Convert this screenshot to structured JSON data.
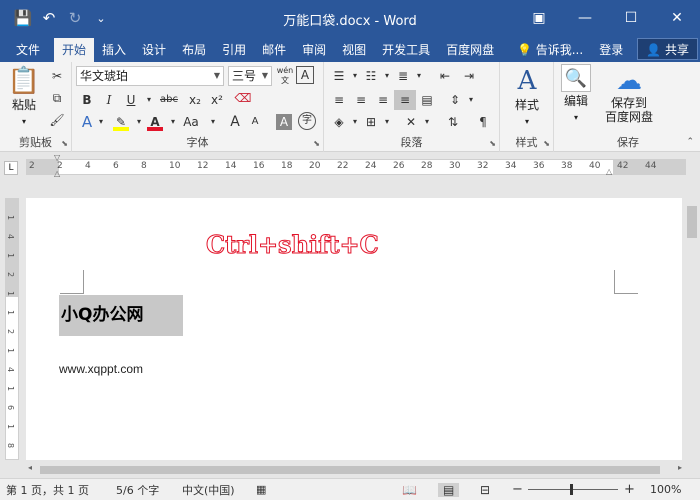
{
  "window": {
    "title": "万能口袋.docx - Word",
    "controls": [
      "restore-icon",
      "minimize-icon",
      "maximize-icon",
      "close-icon"
    ]
  },
  "qat": {
    "save_icon": "💾",
    "undo_icon": "↶",
    "redo_icon": "↻",
    "customize_icon": "⌄"
  },
  "tabs": [
    "文件",
    "开始",
    "插入",
    "设计",
    "布局",
    "引用",
    "邮件",
    "审阅",
    "视图",
    "开发工具",
    "百度网盘"
  ],
  "active_tab": "开始",
  "tellme": "告诉我...",
  "login": "登录",
  "share": "共享",
  "ribbon": {
    "clipboard": {
      "label": "剪贴板",
      "paste": "粘贴"
    },
    "font": {
      "label": "字体",
      "font_name": "华文琥珀",
      "font_size": "三号",
      "bold": "B",
      "italic": "I",
      "underline": "U",
      "strike": "abc",
      "subscript": "x₂",
      "superscript": "x²",
      "change_case": "Aa",
      "grow": "A",
      "shrink": "A",
      "highlight_color": "#ffff00",
      "font_color": "#e2142a"
    },
    "paragraph": {
      "label": "段落"
    },
    "styles": {
      "label": "样式",
      "button": "样式"
    },
    "editing": {
      "button": "编辑"
    },
    "save": {
      "label": "保存",
      "button_line1": "保存到",
      "button_line2": "百度网盘"
    }
  },
  "ruler": {
    "tab_selector": "L",
    "numbers": [
      "2",
      "2",
      "4",
      "6",
      "8",
      "10",
      "12",
      "14",
      "16",
      "18",
      "20",
      "22",
      "24",
      "26",
      "28",
      "30",
      "32",
      "34",
      "36",
      "38",
      "40",
      "42",
      "44"
    ],
    "vertical_numbers": [
      "1",
      "4",
      "1",
      "2",
      "1",
      "1",
      "2",
      "1",
      "4",
      "1",
      "6",
      "1",
      "8"
    ]
  },
  "document": {
    "shortcut_hint": "Ctrl+shift+C",
    "heading": "小Q办公网",
    "website": "www.xqppt.com"
  },
  "status": {
    "page": "第 1 页，共 1 页",
    "words": "5/6 个字",
    "language": "中文(中国)",
    "zoom": "100%",
    "zoom_minus": "−",
    "zoom_plus": "+"
  }
}
